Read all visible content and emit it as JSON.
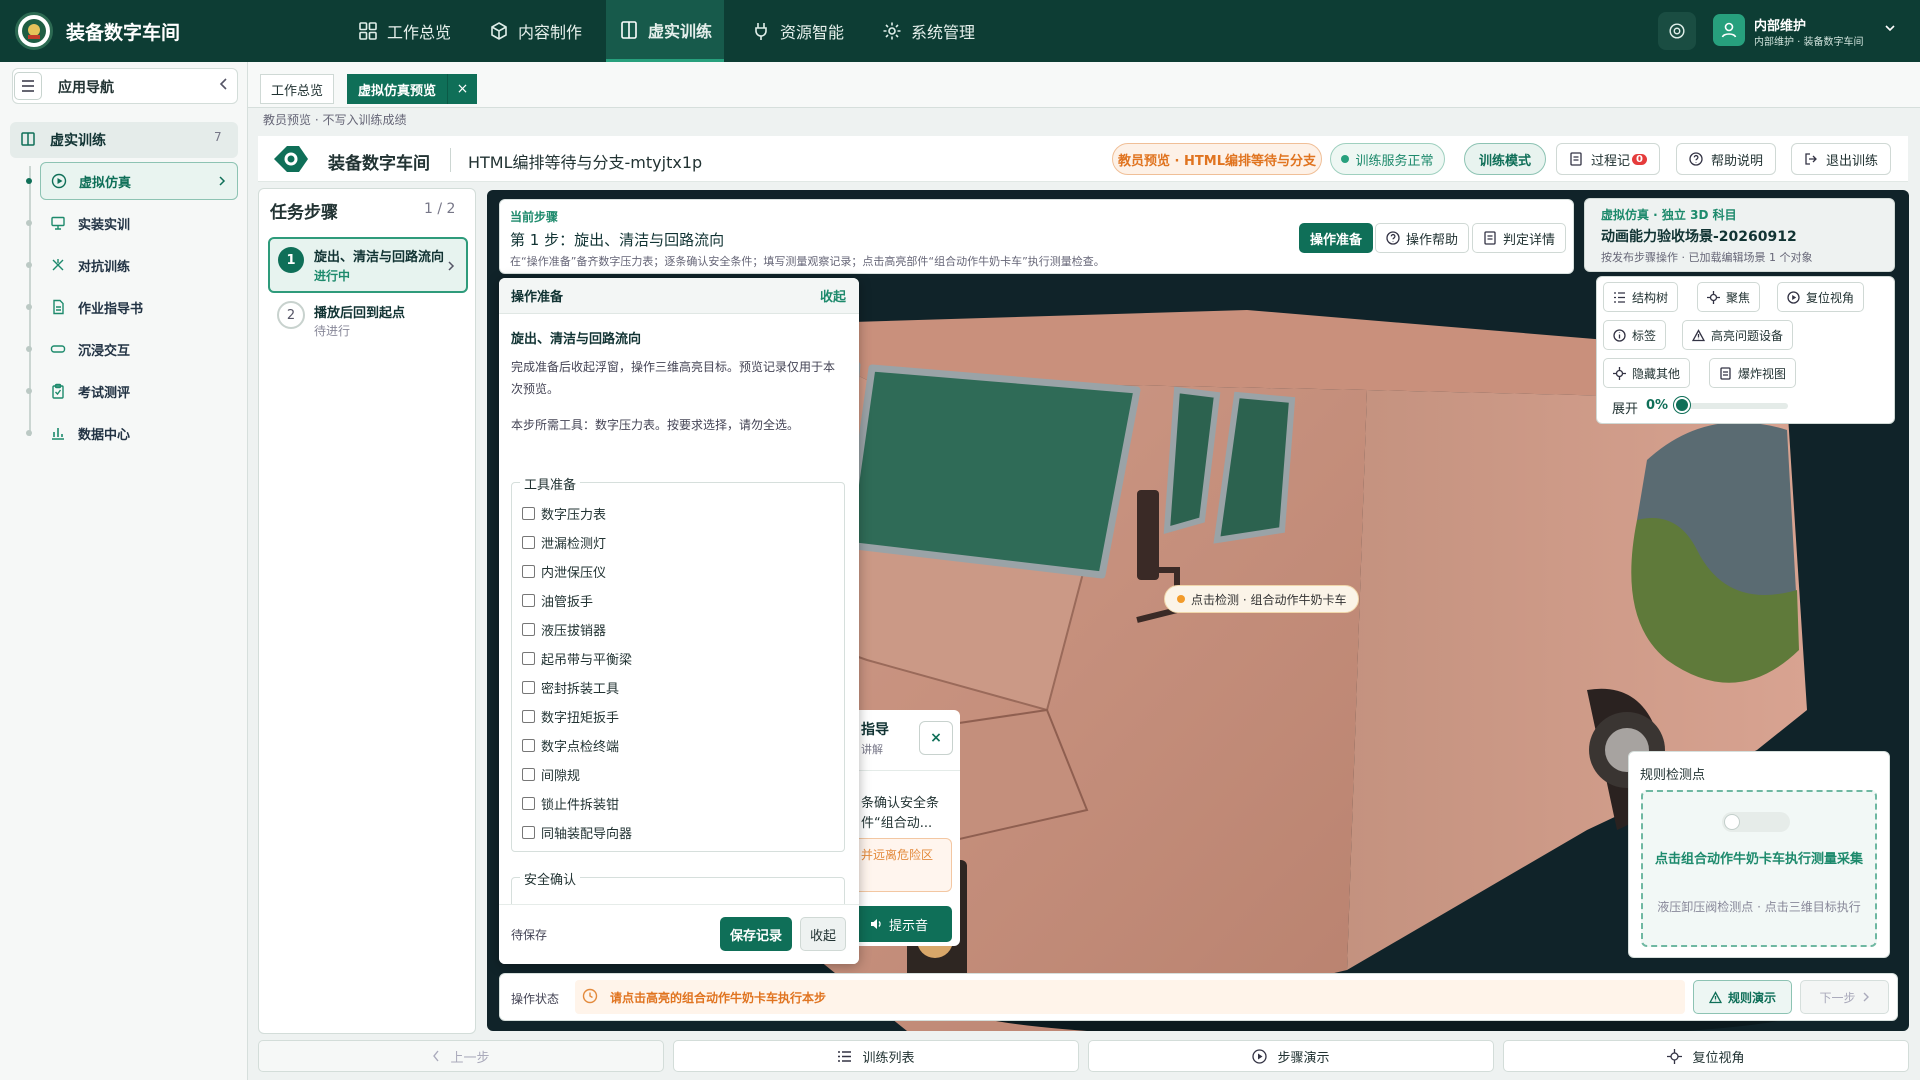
{
  "topbar": {
    "app_name": "装备数字车间",
    "nav": [
      {
        "label": "工作总览",
        "icon": "grid-icon"
      },
      {
        "label": "内容制作",
        "icon": "cube-icon"
      },
      {
        "label": "虚实训练",
        "icon": "book-icon",
        "active": true
      },
      {
        "label": "资源智能",
        "icon": "plug-icon"
      },
      {
        "label": "系统管理",
        "icon": "gear-icon"
      }
    ],
    "user_name": "内部维护",
    "user_sub": "内部维护 · 装备数字车间"
  },
  "sidebar": {
    "title": "应用导航",
    "group_label": "虚实训练",
    "group_count": "7",
    "items": [
      {
        "label": "虚拟仿真",
        "icon": "play-circle-icon",
        "active": true
      },
      {
        "label": "实装实训",
        "icon": "monitor-icon"
      },
      {
        "label": "对抗训练",
        "icon": "swords-icon"
      },
      {
        "label": "作业指导书",
        "icon": "document-icon"
      },
      {
        "label": "沉浸交互",
        "icon": "vr-icon"
      },
      {
        "label": "考试测评",
        "icon": "clipboard-icon"
      },
      {
        "label": "数据中心",
        "icon": "bar-chart-icon"
      }
    ]
  },
  "tabs": {
    "items": [
      "工作总览",
      "虚拟仿真预览"
    ],
    "close": "×"
  },
  "breadcrumb": "教员预览 · 不写入训练成绩",
  "header": {
    "brand": "装备数字车间",
    "title": "HTML编排等待与分支-mtyjtx1p",
    "preview_pill": "教员预览 · HTML编排等待与分支",
    "service_pill": "训练服务正常",
    "mode_pill": "训练模式",
    "record_btn": "过程记",
    "record_badge": "0",
    "help_btn": "帮助说明",
    "exit_btn": "退出训练"
  },
  "steps": {
    "title": "任务步骤",
    "count": "1 / 2",
    "items": [
      {
        "num": "1",
        "title": "旋出、清洁与回路流向",
        "status": "进行中"
      },
      {
        "num": "2",
        "title": "播放后回到起点",
        "status": "待进行"
      }
    ]
  },
  "current_step": {
    "tag": "当前步骤",
    "title": "第 1 步：旋出、清洁与回路流向",
    "desc": "在“操作准备”备齐数字压力表；逐条确认安全条件；填写测量观察记录；点击高亮部件“组合动作牛奶卡车”执行测量检查。",
    "btn_prep": "操作准备",
    "btn_help": "操作帮助",
    "btn_detail": "判定详情"
  },
  "scene_card": {
    "tag": "虚拟仿真 · 独立 3D 科目",
    "title": "动画能力验收场景-20260912",
    "sub": "按发布步骤操作 · 已加载编辑场景 1 个对象"
  },
  "scene_tools": {
    "buttons": [
      "结构树",
      "聚焦",
      "复位视角",
      "标签",
      "高亮问题设备",
      "隐藏其他",
      "爆炸视图"
    ],
    "expand_label": "展开",
    "expand_value": "0%",
    "expand_fraction": 0
  },
  "prep_panel": {
    "title": "操作准备",
    "collapse": "收起",
    "subtitle": "旋出、清洁与回路流向",
    "p1": "完成准备后收起浮窗，操作三维高亮目标。预览记录仅用于本次预览。",
    "p2": "本步所需工具：数字压力表。按要求选择，请勿全选。",
    "tools_legend": "工具准备",
    "tools": [
      "数字压力表",
      "泄漏检测灯",
      "内泄保压仪",
      "油管扳手",
      "液压拔销器",
      "起吊带与平衡梁",
      "密封拆装工具",
      "数字扭矩扳手",
      "数字点检终端",
      "间隙规",
      "锁止件拆装钳",
      "同轴装配导向器"
    ],
    "safety_legend": "安全确认",
    "state": "待保存",
    "save": "保存记录",
    "fold": "收起"
  },
  "guide_card": {
    "title": "指导",
    "sub": "讲解",
    "line1": "条确认安全条",
    "line2": "件“组合动...",
    "warn": "并远离危险区",
    "sound": "提示音",
    "close": "×"
  },
  "hotspot": {
    "label": "点击检测 · 组合动作牛奶卡车"
  },
  "rule_card": {
    "title": "规则检测点",
    "main": "点击组合动作牛奶卡车执行测量采集",
    "sub": "液压卸压阀检测点 · 点击三维目标执行"
  },
  "op_status": {
    "label": "操作状态",
    "message": "请点击高亮的组合动作牛奶卡车执行本步",
    "rule_btn": "规则演示",
    "next_btn": "下一步"
  },
  "bottom": {
    "prev": "上一步",
    "list": "训练列表",
    "demo": "步骤演示",
    "reset": "复位视角"
  },
  "colors": {
    "topbar": "#0d3d34",
    "accent": "#0f6f58",
    "accent_light": "#27a07d",
    "warning": "#e07420",
    "truck_body": "#d9a592",
    "truck_glass": "#2f6b57",
    "viewport_bg": "#102329"
  }
}
